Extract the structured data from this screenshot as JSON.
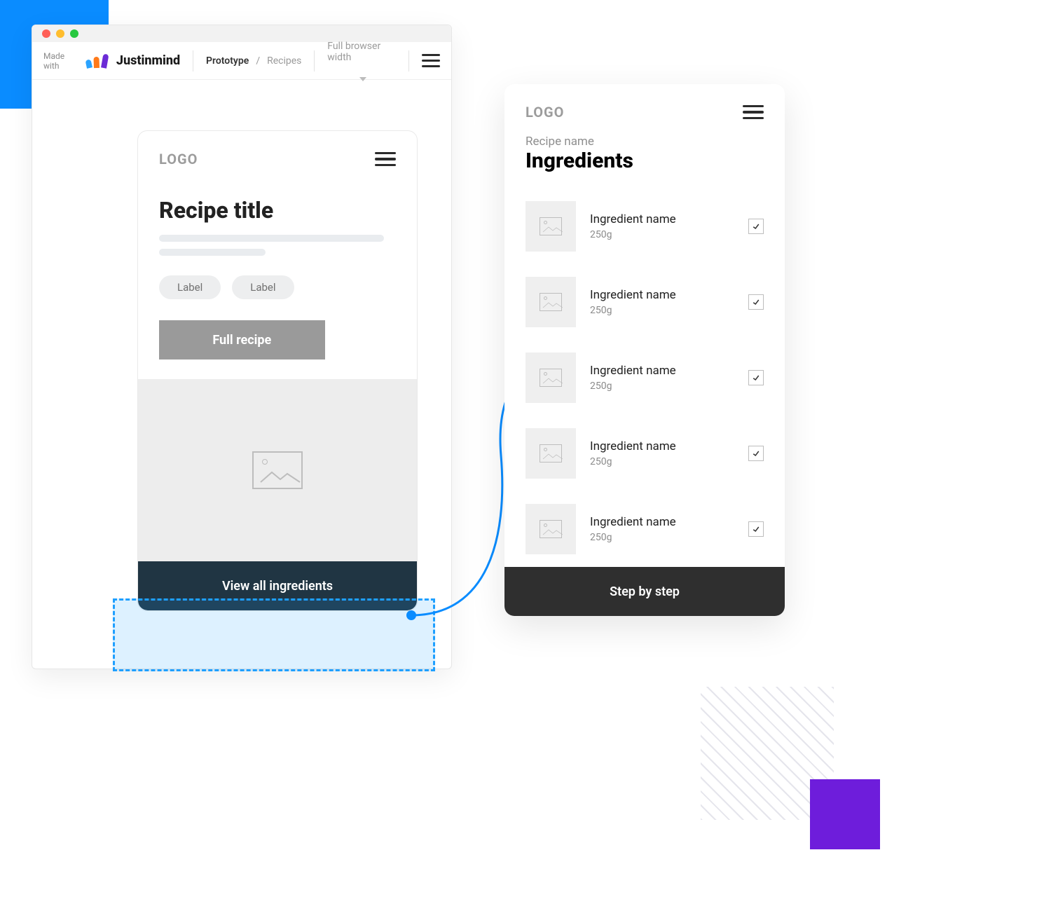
{
  "toolbar": {
    "made_with": "Made with",
    "brand": "Justinmind",
    "crumb_main": "Prototype",
    "crumb_sep": "/",
    "crumb_sub": "Recipes",
    "view_mode": "Full browser width"
  },
  "left_phone": {
    "logo": "LOGO",
    "title": "Recipe title",
    "labels": [
      "Label",
      "Label"
    ],
    "full_button": "Full recipe",
    "cta": "View all ingredients"
  },
  "right_phone": {
    "logo": "LOGO",
    "subhead": "Recipe name",
    "heading": "Ingredients",
    "ingredients": [
      {
        "name": "Ingredient name",
        "qty": "250g",
        "checked": true
      },
      {
        "name": "Ingredient name",
        "qty": "250g",
        "checked": true
      },
      {
        "name": "Ingredient name",
        "qty": "250g",
        "checked": true
      },
      {
        "name": "Ingredient name",
        "qty": "250g",
        "checked": true
      },
      {
        "name": "Ingredient name",
        "qty": "250g",
        "checked": true
      }
    ],
    "cta": "Step by step"
  }
}
